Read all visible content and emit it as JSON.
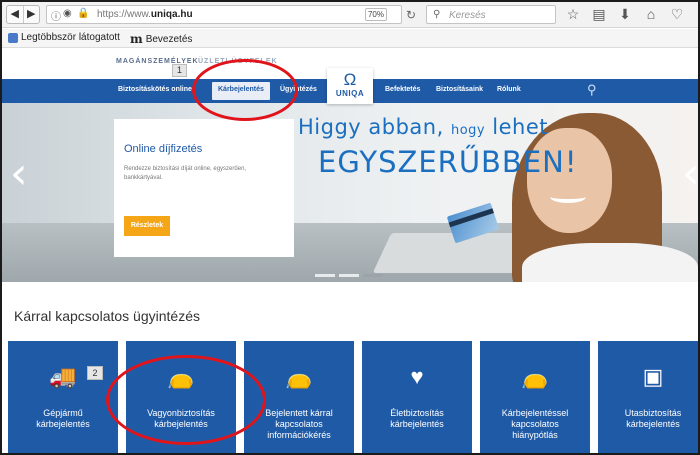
{
  "browser": {
    "url_prefix": "https://www.",
    "url_domain": "uniqa.hu",
    "zoom": "70%",
    "search_placeholder": "Keresés",
    "bookmarks": [
      {
        "label": "Legtöbbször látogatott"
      },
      {
        "label": "Bevezetés",
        "logo": "m"
      }
    ]
  },
  "site": {
    "segments": [
      "MAGÁNSZEMÉLYEK",
      "ÜZLETI ÜGYFELEK"
    ],
    "badge": "1",
    "logo_text": "UNIQA",
    "nav": [
      {
        "label": "Biztosításkötés online"
      },
      {
        "label": "Kárbejelentés"
      },
      {
        "label": "Ügyintézés"
      },
      {
        "label": "Befektetés"
      },
      {
        "label": "Biztosításaink"
      },
      {
        "label": "Rólunk"
      }
    ]
  },
  "hero": {
    "headline_1_a": "Higgy abban,",
    "headline_1_b": "hogy",
    "headline_1_c": "lehet",
    "headline_2": "EGYSZERŰBBEN!",
    "promo_title": "Online díjfizetés",
    "promo_desc": "Rendezze biztosítási díját online, egyszerűen, bankkártyával.",
    "promo_button": "Részletek",
    "active_slide": 3,
    "slide_count": 3
  },
  "section": {
    "title": "Kárral kapcsolatos ügyintézés",
    "badge": "2",
    "tiles": [
      {
        "label": "Gépjármű\nkárbejelentés",
        "icon": "car-crash-icon"
      },
      {
        "label": "Vagyonbiztosítás\nkárbejelentés",
        "icon": "money-bag-icon"
      },
      {
        "label": "Bejelentett kárral\nkapcsolatos\ninformációkérés",
        "icon": "money-bag-info-icon"
      },
      {
        "label": "Életbiztosítás\nkárbejelentés",
        "icon": "heart-shield-icon"
      },
      {
        "label": "Kárbejelentéssel\nkapcsolatos\nhiánypótlás",
        "icon": "money-bag-plus-icon"
      },
      {
        "label": "Utasbiztosítás\nkárbejelentés",
        "icon": "suitcase-icon"
      }
    ]
  },
  "colors": {
    "brand_blue": "#1f5aa6",
    "accent_orange": "#f5a616",
    "annotation_red": "#e0141b"
  }
}
